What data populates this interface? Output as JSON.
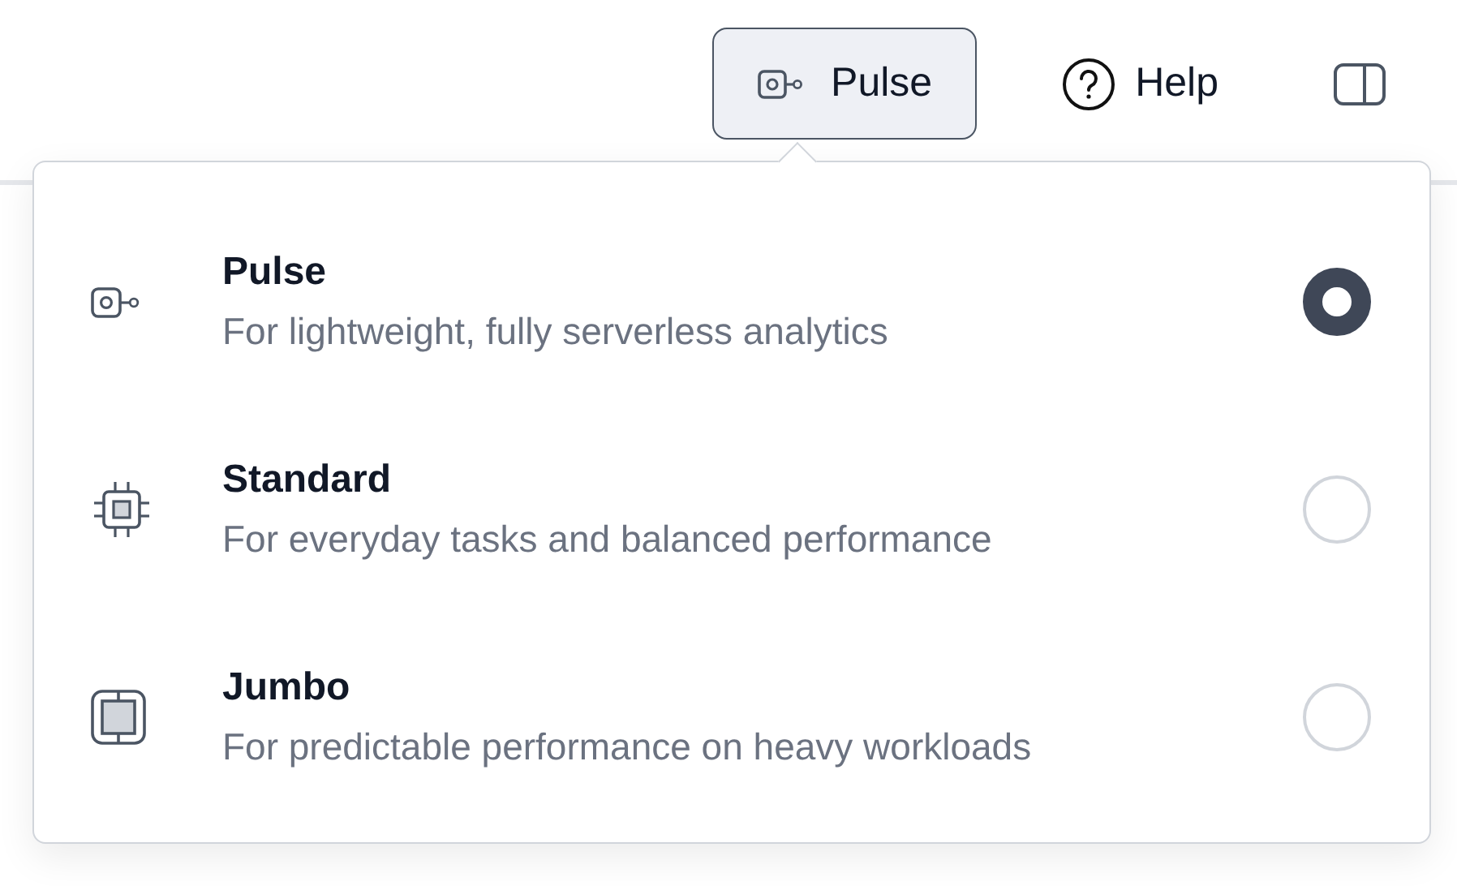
{
  "toolbar": {
    "plan_button": {
      "label": "Pulse",
      "expanded": true
    },
    "help_button": {
      "label": "Help"
    }
  },
  "plan_menu": {
    "options": [
      {
        "kind": "pulse",
        "title": "Pulse",
        "description": "For lightweight, fully serverless analytics",
        "selected": true
      },
      {
        "kind": "chip",
        "title": "Standard",
        "description": "For everyday tasks and balanced performance",
        "selected": false
      },
      {
        "kind": "block",
        "title": "Jumbo",
        "description": "For predictable performance on heavy workloads",
        "selected": false
      }
    ]
  }
}
